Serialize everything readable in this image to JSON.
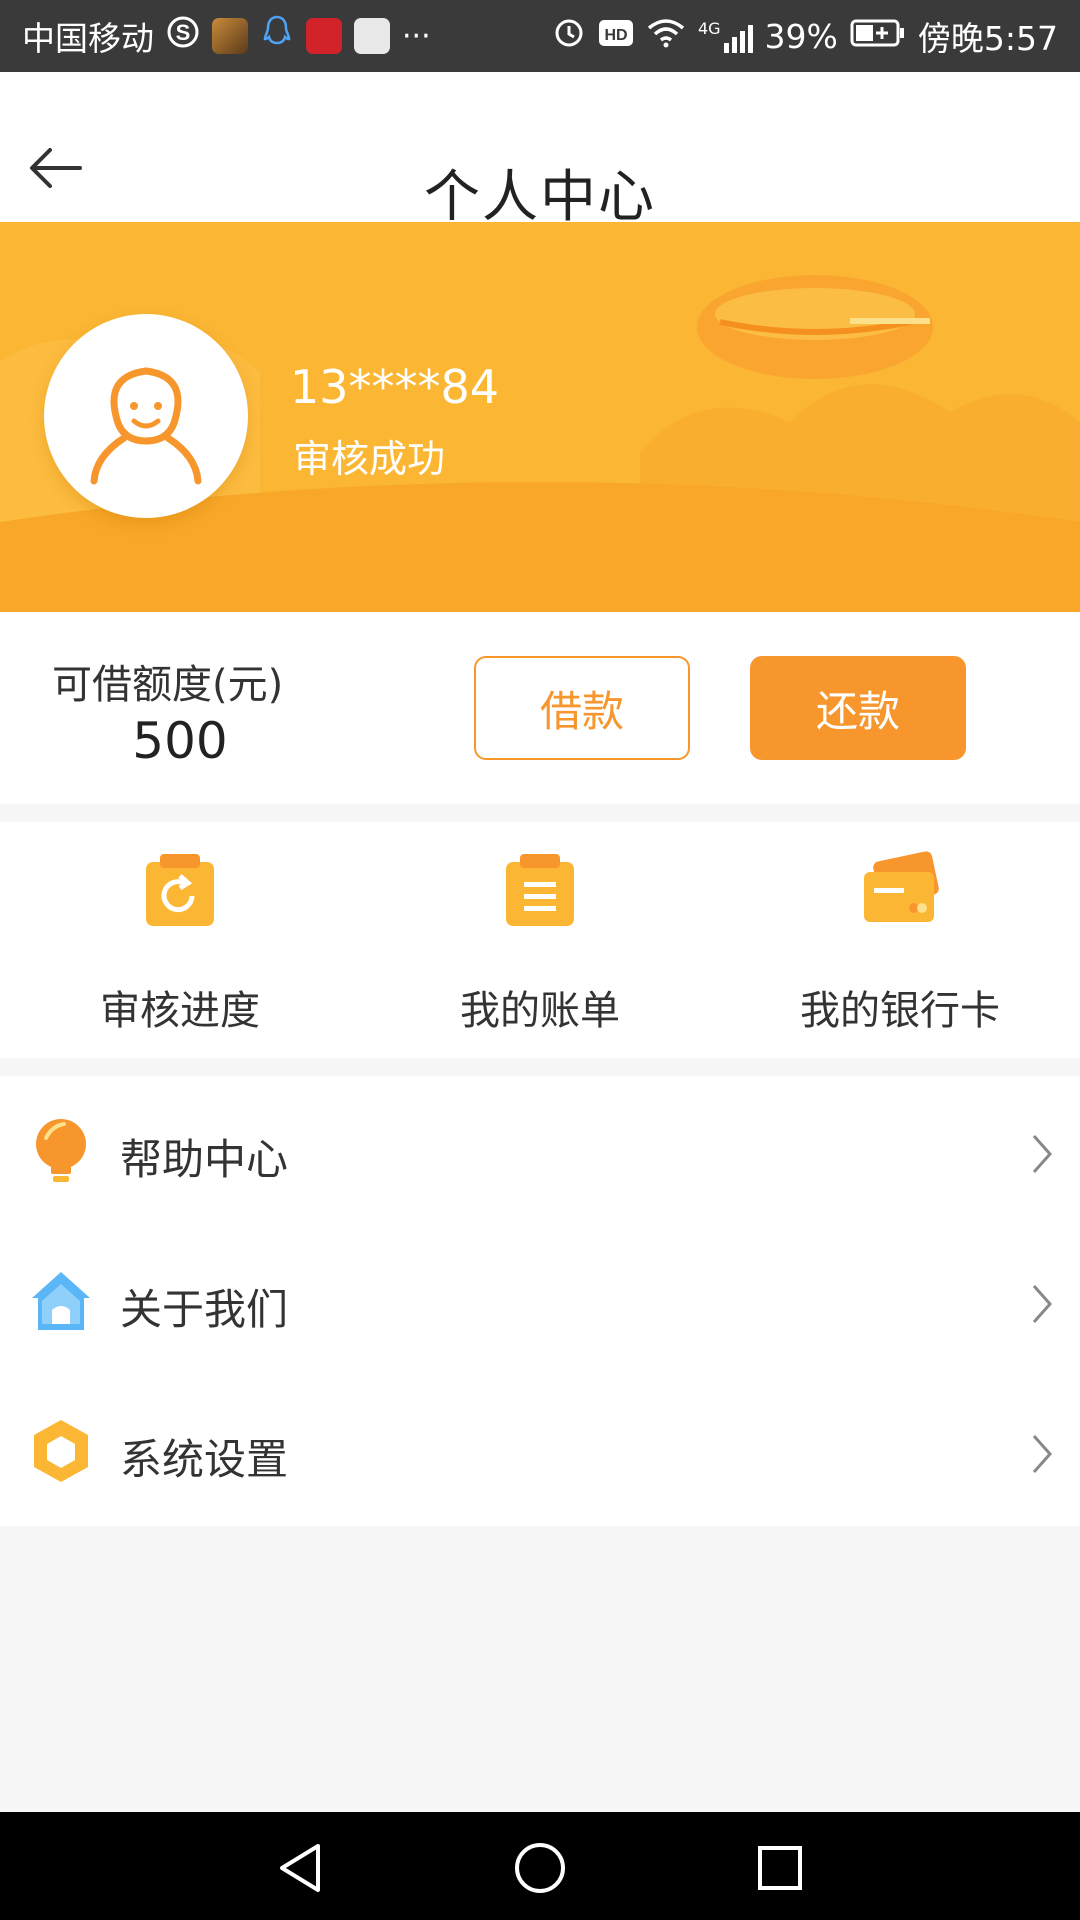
{
  "status_bar": {
    "carrier": "中国移动",
    "battery": "39%",
    "time": "傍晚5:57",
    "more": "···",
    "network": "4G",
    "icons": [
      "sogou-icon",
      "game-icon",
      "qq-icon",
      "weibo-icon",
      "video-icon",
      "alarm-icon",
      "hd-icon",
      "wifi-icon",
      "signal-icon",
      "battery-icon"
    ]
  },
  "header": {
    "title": "个人中心",
    "back_icon": "arrow-left-icon"
  },
  "profile": {
    "phone": "13****84",
    "status": "审核成功",
    "avatar_icon": "user-avatar-icon"
  },
  "credit": {
    "label": "可借额度(元)",
    "amount": "500",
    "borrow_label": "借款",
    "repay_label": "还款"
  },
  "shortcuts": [
    {
      "label": "审核进度",
      "icon": "review-progress-icon"
    },
    {
      "label": "我的账单",
      "icon": "bill-icon"
    },
    {
      "label": "我的银行卡",
      "icon": "bank-card-icon"
    }
  ],
  "menu": [
    {
      "label": "帮助中心",
      "icon": "lightbulb-icon"
    },
    {
      "label": "关于我们",
      "icon": "home-icon"
    },
    {
      "label": "系统设置",
      "icon": "settings-hexagon-icon"
    }
  ],
  "colors": {
    "accent": "#f7962c",
    "banner": "#fbb634",
    "text": "#333333"
  }
}
